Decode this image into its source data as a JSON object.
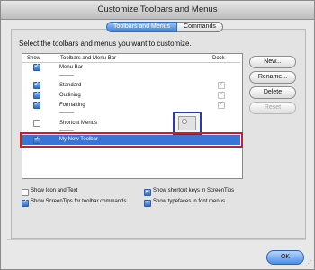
{
  "window": {
    "title": "Customize Toolbars and Menus"
  },
  "tabs": [
    {
      "label": "Toolbars and Menus",
      "active": true
    },
    {
      "label": "Commands",
      "active": false
    }
  ],
  "instructions": "Select the toolbars and menus you want to customize.",
  "list": {
    "columns": {
      "show": "Show",
      "name": "Toolbars and Menu Bar",
      "dock": "Dock"
    },
    "rows": [
      {
        "name": "Menu Bar",
        "show": true,
        "dock": null
      },
      {
        "name": "--------",
        "show": null,
        "dock": null
      },
      {
        "name": "Standard",
        "show": true,
        "dock": true
      },
      {
        "name": "Outlining",
        "show": true,
        "dock": true
      },
      {
        "name": "Formatting",
        "show": true,
        "dock": true
      },
      {
        "name": "--------",
        "show": null,
        "dock": null
      },
      {
        "name": "Shortcut Menus",
        "show": false,
        "dock": null
      },
      {
        "name": "--------",
        "show": null,
        "dock": null
      },
      {
        "name": "My New Toolbar",
        "show": true,
        "dock": null,
        "selected": true
      }
    ]
  },
  "buttons": {
    "new": "New...",
    "rename": "Rename...",
    "delete": "Delete",
    "reset": "Reset"
  },
  "options": {
    "show_icon_text": {
      "label": "Show Icon and Text",
      "checked": false
    },
    "show_screentips": {
      "label": "Show ScreenTips for toolbar commands",
      "checked": true
    },
    "show_shortcut_keys": {
      "label": "Show shortcut keys in ScreenTips",
      "checked": true
    },
    "show_typefaces": {
      "label": "Show typefaces in font menus",
      "checked": true
    }
  },
  "ok_label": "OK",
  "colors": {
    "selection": "#3875d7",
    "highlight_frame": "#d21c24",
    "popup_frame": "#2a3aa8"
  }
}
